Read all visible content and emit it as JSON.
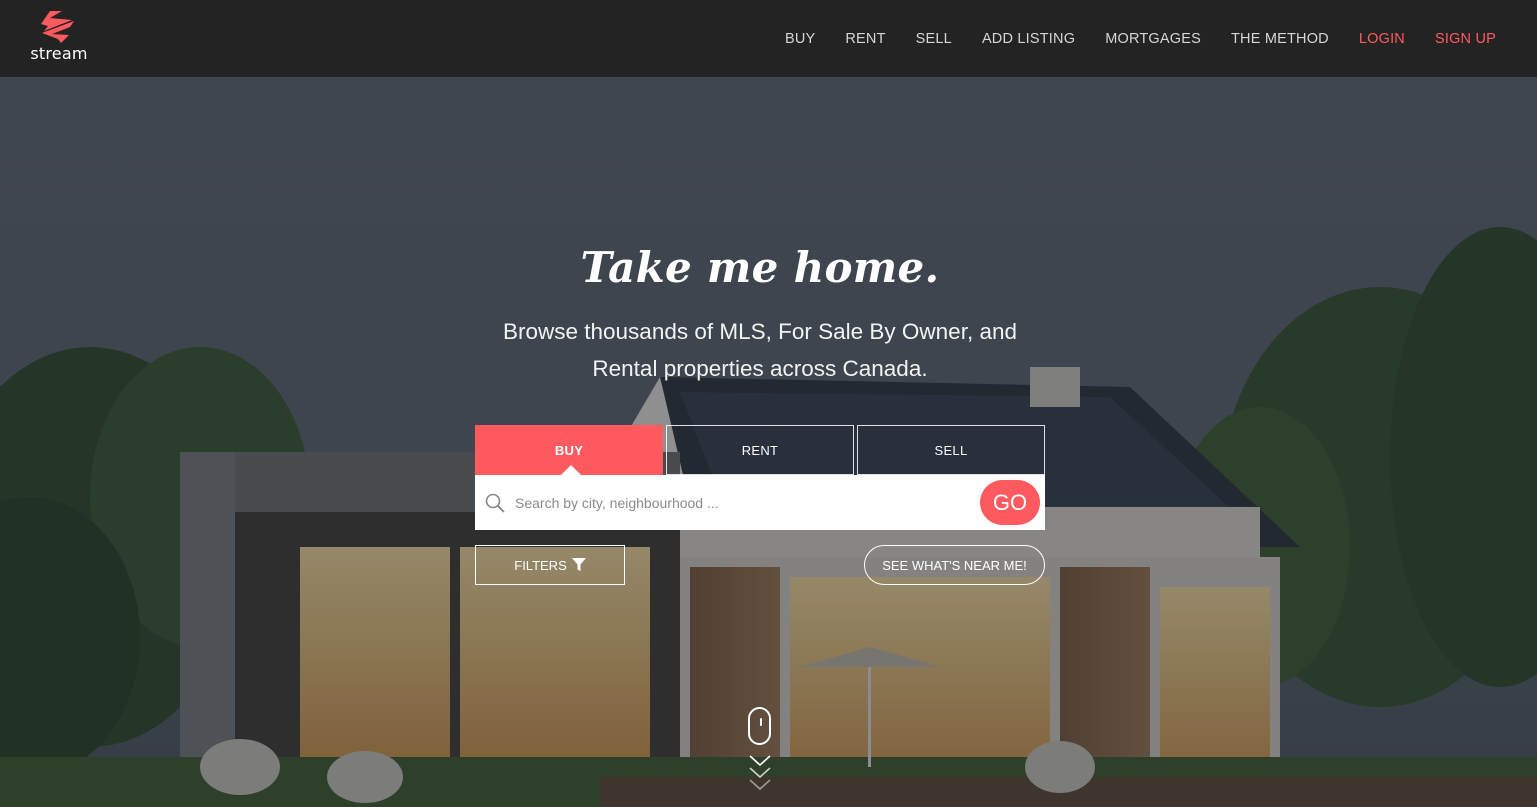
{
  "brand": {
    "name": "stream",
    "accent": "#ff5a5f"
  },
  "nav": {
    "items": [
      "BUY",
      "RENT",
      "SELL",
      "ADD LISTING",
      "MORTGAGES",
      "THE METHOD"
    ],
    "login": "LOGIN",
    "signup": "SIGN UP"
  },
  "hero": {
    "headline": "Take me home.",
    "subhead": "Browse thousands of MLS, For Sale By Owner, and Rental properties across Canada."
  },
  "search": {
    "tabs": [
      "BUY",
      "RENT",
      "SELL"
    ],
    "active_tab": "BUY",
    "placeholder": "Search by city, neighbourhood ...",
    "value": "",
    "go_label": "GO"
  },
  "actions": {
    "filters_label": "FILTERS",
    "near_me_label": "SEE WHAT'S NEAR ME!"
  },
  "icons": {
    "logo": "stream-logo-icon",
    "search": "search-icon",
    "filter": "funnel-icon",
    "scroll": "mouse-scroll-icon"
  }
}
